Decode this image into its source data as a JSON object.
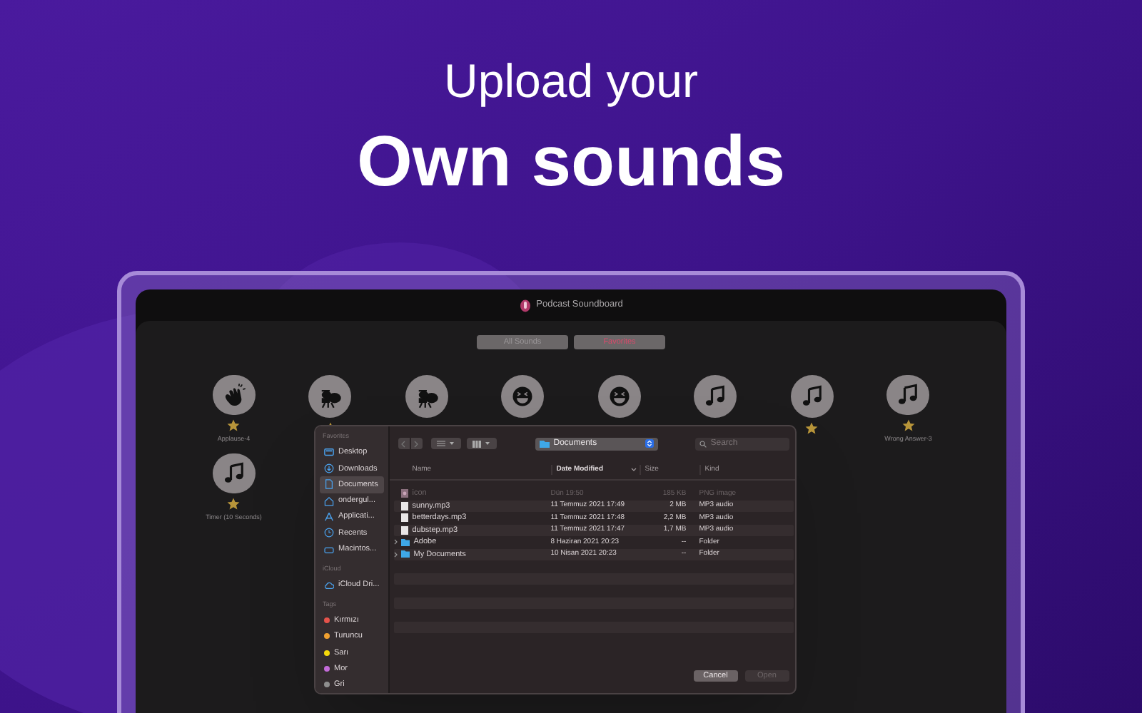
{
  "headline": {
    "line_1": "Upload your",
    "line_2": "Own sounds"
  },
  "app": {
    "title": "Podcast Soundboard",
    "tabs": [
      {
        "label": "All Sounds",
        "selected": false
      },
      {
        "label": "Favorites",
        "selected": true
      }
    ],
    "sounds": [
      {
        "kind": "applause",
        "favorite": true,
        "label": "Applause-4"
      },
      {
        "kind": "drums",
        "favorite": true
      },
      {
        "kind": "drums"
      },
      {
        "kind": "laugh"
      },
      {
        "kind": "laugh"
      },
      {
        "kind": "music"
      },
      {
        "kind": "music",
        "favorite": true
      },
      {
        "kind": "music",
        "favorite": true,
        "label": "Wrong Answer-3"
      },
      {
        "kind": "music",
        "favorite": true,
        "label": "Timer (10 Seconds)"
      }
    ]
  },
  "dialog": {
    "sidebar": [
      {
        "heading": "Favorites",
        "items": [
          {
            "label": "Desktop",
            "kind": "desktop",
            "selected": false
          },
          {
            "label": "Downloads",
            "kind": "download",
            "selected": false
          },
          {
            "label": "Documents",
            "kind": "document",
            "selected": true
          },
          {
            "label": "ondergul...",
            "kind": "home",
            "selected": false
          },
          {
            "label": "Applicati...",
            "kind": "apps",
            "selected": false
          },
          {
            "label": "Recents",
            "kind": "clock",
            "selected": false
          },
          {
            "label": "Macintos...",
            "kind": "disk",
            "selected": false
          }
        ]
      },
      {
        "heading": "iCloud",
        "items": [
          {
            "label": "iCloud Dri...",
            "kind": "cloud",
            "selected": false
          }
        ]
      },
      {
        "heading": "Tags",
        "items": [
          {
            "label": "Kırmızı",
            "kind": "tag",
            "color": "#e5534b",
            "selected": false
          },
          {
            "label": "Turuncu",
            "kind": "tag",
            "color": "#f0a030",
            "selected": false
          },
          {
            "label": "Sarı",
            "kind": "tag",
            "color": "#f5d90a",
            "selected": false
          },
          {
            "label": "Mor",
            "kind": "tag",
            "color": "#c36bd8",
            "selected": false
          },
          {
            "label": "Gri",
            "kind": "tag",
            "color": "#8e8e8e",
            "selected": false
          }
        ]
      }
    ],
    "location": "Documents",
    "search": {
      "placeholder": "Search"
    },
    "columns": [
      "Name",
      "Date Modified",
      "Size",
      "Kind"
    ],
    "rows": [
      {
        "kind": "image",
        "name": "icon",
        "date": "Dün 19:50",
        "size": "185 KB",
        "type": "PNG image",
        "disabled": true
      },
      {
        "kind": "file",
        "name": "sunny.mp3",
        "date": "11 Temmuz 2021 17:49",
        "size": "2 MB",
        "type": "MP3 audio",
        "disabled": false
      },
      {
        "kind": "file",
        "name": "betterdays.mp3",
        "date": "11 Temmuz 2021 17:48",
        "size": "2,2 MB",
        "type": "MP3 audio",
        "disabled": false
      },
      {
        "kind": "file",
        "name": "dubstep.mp3",
        "date": "11 Temmuz 2021 17:47",
        "size": "1,7 MB",
        "type": "MP3 audio",
        "disabled": false
      },
      {
        "kind": "folder",
        "name": "Adobe",
        "date": "8 Haziran 2021 20:23",
        "size": "--",
        "type": "Folder",
        "disabled": false
      },
      {
        "kind": "folder",
        "name": "My Documents",
        "date": "10 Nisan 2021 20:23",
        "size": "--",
        "type": "Folder",
        "disabled": false
      }
    ],
    "buttons": [
      {
        "label": "Cancel",
        "disabled": false
      },
      {
        "label": "Open",
        "disabled": true
      }
    ]
  }
}
